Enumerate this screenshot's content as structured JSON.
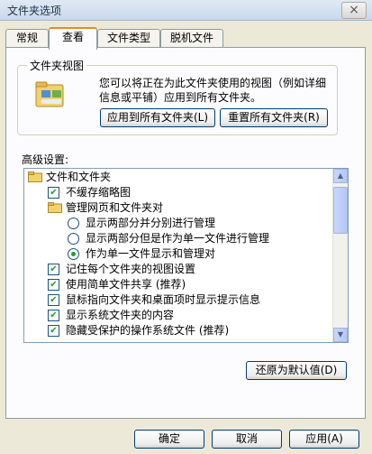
{
  "window": {
    "title": "文件夹选项",
    "close_glyph": "×"
  },
  "tabs": [
    {
      "label": "常规"
    },
    {
      "label": "查看"
    },
    {
      "label": "文件类型"
    },
    {
      "label": "脱机文件"
    }
  ],
  "folder_views": {
    "label": "文件夹视图",
    "description": "您可以将正在为此文件夹使用的视图（例如详细信息或平铺）应用到所有文件夹。",
    "apply_button": "应用到所有文件夹(L)",
    "reset_button": "重置所有文件夹(R)"
  },
  "advanced": {
    "label": "高级设置:",
    "items": [
      {
        "type": "folder",
        "label": "文件和文件夹"
      },
      {
        "type": "checkbox",
        "label": "不缓存缩略图",
        "checked": true
      },
      {
        "type": "folder",
        "label": "管理网页和文件夹对"
      },
      {
        "type": "radio",
        "label": "显示两部分并分别进行管理",
        "checked": false
      },
      {
        "type": "radio",
        "label": "显示两部分但是作为单一文件进行管理",
        "checked": false
      },
      {
        "type": "radio",
        "label": "作为单一文件显示和管理对",
        "checked": true
      },
      {
        "type": "checkbox",
        "label": "记住每个文件夹的视图设置",
        "checked": true
      },
      {
        "type": "checkbox",
        "label": "使用简单文件共享 (推荐)",
        "checked": true
      },
      {
        "type": "checkbox",
        "label": "鼠标指向文件夹和桌面项时显示提示信息",
        "checked": true
      },
      {
        "type": "checkbox",
        "label": "显示系统文件夹的内容",
        "checked": true
      },
      {
        "type": "checkbox",
        "label": "隐藏受保护的操作系统文件 (推荐)",
        "checked": true
      }
    ],
    "check_glyph": "✔"
  },
  "restore_button": "还原为默认值(D)",
  "dialog_buttons": {
    "ok": "确定",
    "cancel": "取消",
    "apply": "应用(A)"
  },
  "colors": {
    "accent_tab": "#e68b2c",
    "check_green": "#21a121"
  }
}
